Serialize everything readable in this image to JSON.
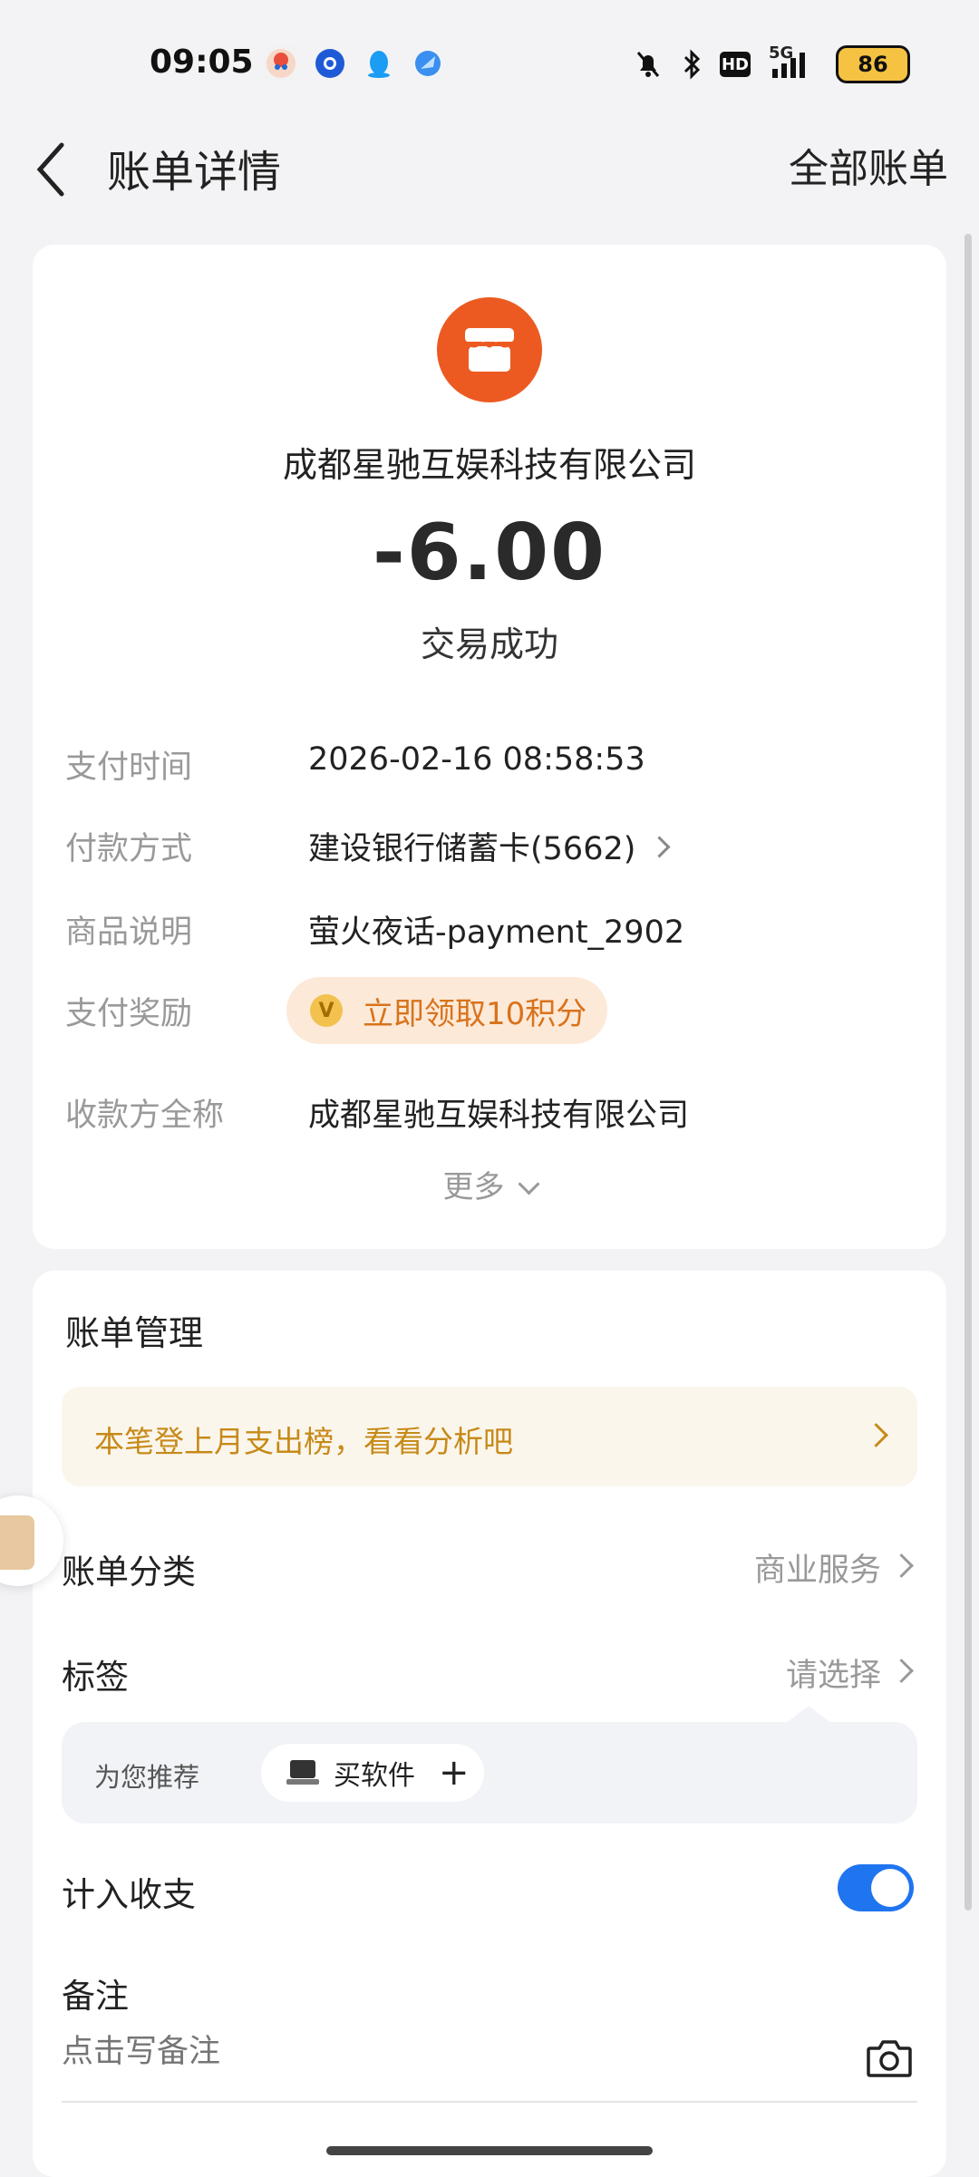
{
  "status_bar": {
    "time": "09:05",
    "battery": "86",
    "signal_label": "5G",
    "hd_label": "HD",
    "icons": [
      "app-icon-1",
      "app-icon-2",
      "qq-icon",
      "app-icon-4",
      "mute-icon",
      "bluetooth-icon",
      "hd-icon",
      "signal-icon",
      "battery-icon"
    ]
  },
  "nav": {
    "title": "账单详情",
    "right_action": "全部账单"
  },
  "transaction": {
    "merchant_name": "成都星驰互娱科技有限公司",
    "amount": "-6.00",
    "status": "交易成功",
    "details": [
      {
        "label": "支付时间",
        "value": "2026-02-16 08:58:53"
      },
      {
        "label": "付款方式",
        "value": "建设银行储蓄卡(5662)"
      },
      {
        "label": "商品说明",
        "value": "萤火夜话-payment_2902"
      },
      {
        "label": "支付奖励",
        "value": "立即领取10积分"
      },
      {
        "label": "收款方全称",
        "value": "成都星驰互娱科技有限公司"
      }
    ],
    "more": "更多"
  },
  "management": {
    "title": "账单管理",
    "banner": "本笔登上月支出榜，看看分析吧",
    "category_label": "账单分类",
    "category_value": "商业服务",
    "tag_label": "标签",
    "tag_value": "请选择",
    "recommend_label": "为您推荐",
    "recommend_chip": "买软件",
    "include_label": "计入收支",
    "include_enabled": true,
    "note_label": "备注",
    "note_placeholder": "点击写备注"
  },
  "colors": {
    "accent": "#1f74f0",
    "merchant_logo": "#ec5a21",
    "reward_bg": "#fde9d8",
    "reward_text": "#d8731b",
    "banner_text": "#c78a18"
  }
}
